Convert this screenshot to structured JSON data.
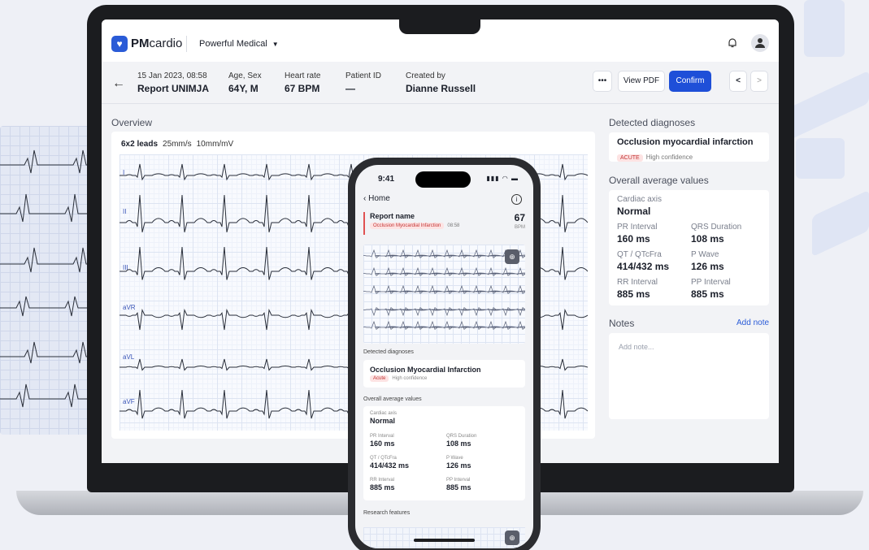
{
  "app": {
    "logo_icon": "heart-logo-icon",
    "logo_bold": "PM",
    "logo_rest": "cardio",
    "organization": "Powerful Medical",
    "icons": [
      "bell-icon",
      "user-icon",
      "arrow-left-icon",
      "more-icon",
      "chevron-left-icon",
      "chevron-right-icon"
    ]
  },
  "report": {
    "datetime": "15 Jan 2023, 08:58",
    "name": "Report UNIMJA",
    "age_sex_label": "Age, Sex",
    "age_sex": "64Y, M",
    "hr_label": "Heart rate",
    "hr": "67 BPM",
    "pid_label": "Patient ID",
    "pid": "—",
    "created_label": "Created by",
    "created_by": "Dianne Russell",
    "more": "•••",
    "view_pdf": "View PDF",
    "confirm": "Confirm",
    "prev": "<",
    "next": ">"
  },
  "overview": {
    "title": "Overview",
    "layout": "6x2 leads",
    "speed": "25mm/s",
    "gain": "10mm/mV",
    "leads": [
      "I",
      "II",
      "III",
      "aVR",
      "aVL",
      "aVF"
    ]
  },
  "diagnoses": {
    "title": "Detected diagnoses",
    "name": "Occlusion myocardial infarction",
    "badge": "ACUTE",
    "confidence": "High confidence"
  },
  "averages": {
    "title": "Overall average values",
    "axis_label": "Cardiac axis",
    "axis_value": "Normal",
    "items": [
      {
        "label": "PR Interval",
        "value": "160 ms"
      },
      {
        "label": "QRS Duration",
        "value": "108 ms"
      },
      {
        "label": "QT / QTcFra",
        "value": "414/432 ms"
      },
      {
        "label": "P Wave",
        "value": "126 ms"
      },
      {
        "label": "RR Interval",
        "value": "885 ms"
      },
      {
        "label": "PP Interval",
        "value": "885 ms"
      }
    ]
  },
  "notes": {
    "title": "Notes",
    "add": "Add note",
    "placeholder": "Add note..."
  },
  "phone": {
    "time": "9:41",
    "status": "▮▮▮ ◠ ▬",
    "back": "Home",
    "info": "i",
    "report_name": "Report name",
    "report_badge": "Occlusion Myocardial Infarction",
    "report_time": "08:58",
    "hr": "67",
    "bpm": "BPM",
    "zoom": "⊕",
    "diag_title": "Detected diagnoses",
    "diag_name": "Occlusion Myocardial Infarction",
    "diag_badge": "Acute",
    "diag_conf": "High confidence",
    "avg_title": "Overall average values",
    "axis_label": "Cardiac axis",
    "axis_value": "Normal",
    "items": [
      {
        "label": "PR Interval",
        "value": "160 ms"
      },
      {
        "label": "QRS Duration",
        "value": "108 ms"
      },
      {
        "label": "QT / QTcFra",
        "value": "414/432 ms"
      },
      {
        "label": "P Wave",
        "value": "126 ms"
      },
      {
        "label": "RR Interval",
        "value": "885 ms"
      },
      {
        "label": "PP Interval",
        "value": "885 ms"
      }
    ],
    "research_title": "Research features"
  },
  "colors": {
    "accent": "#1e4fd8",
    "alert": "#c23535",
    "ecg_trace": "#2a2f3a"
  }
}
